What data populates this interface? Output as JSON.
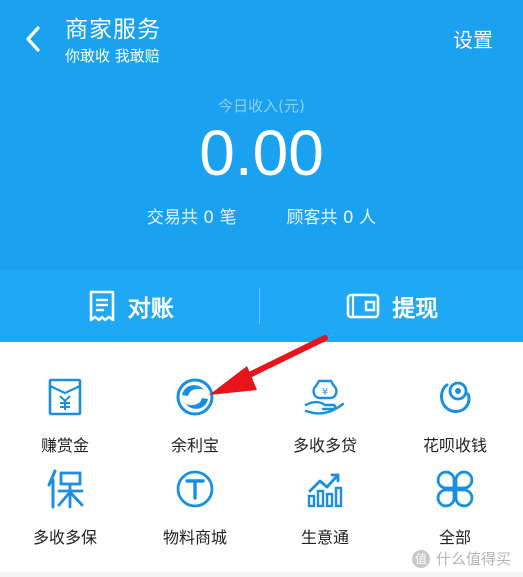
{
  "header": {
    "title": "商家服务",
    "subtitle": "你敢收 我敢赔",
    "settings_label": "设置",
    "back_icon": "chevron-left-icon"
  },
  "income": {
    "label": "今日收入(元)",
    "value": "0.00"
  },
  "stats": {
    "transactions": "交易共 0 笔",
    "customers": "顾客共 0 人"
  },
  "actions": {
    "reconcile": {
      "label": "对账",
      "icon": "receipt-icon"
    },
    "withdraw": {
      "label": "提现",
      "icon": "wallet-icon"
    }
  },
  "grid": [
    {
      "label": "赚赏金",
      "icon": "reward-envelope-icon"
    },
    {
      "label": "余利宝",
      "icon": "yulibao-icon"
    },
    {
      "label": "多收多贷",
      "icon": "loan-hand-icon"
    },
    {
      "label": "花呗收钱",
      "icon": "huabei-icon"
    },
    {
      "label": "多收多保",
      "icon": "insurance-icon"
    },
    {
      "label": "物料商城",
      "icon": "material-store-icon"
    },
    {
      "label": "生意通",
      "icon": "business-chart-icon"
    },
    {
      "label": "全部",
      "icon": "all-services-icon"
    }
  ],
  "watermark": {
    "badge": "值",
    "text": "什么值得买"
  },
  "colors": {
    "header_bg": "#1aa1f0",
    "action_bar_bg": "#1fa8f5",
    "icon_blue": "#1a8fe0",
    "arrow_red": "#e8141b"
  }
}
